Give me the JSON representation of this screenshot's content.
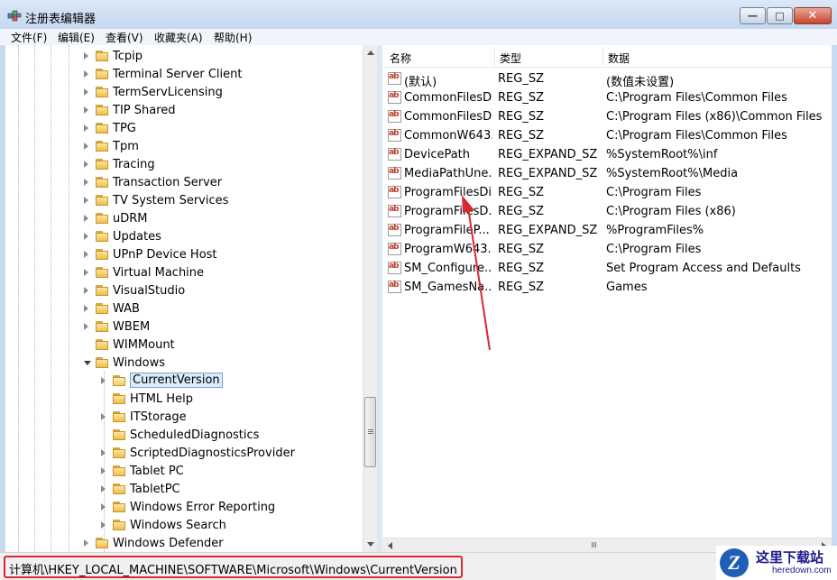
{
  "window": {
    "title": "注册表编辑器",
    "minimize_glyph": "—",
    "maximize_glyph": "□",
    "close_glyph": "✕"
  },
  "menu": [
    "文件(F)",
    "编辑(E)",
    "查看(V)",
    "收藏夹(A)",
    "帮助(H)"
  ],
  "tree": [
    {
      "label": "Tcpip",
      "level": 0,
      "state": "collapsed"
    },
    {
      "label": "Terminal Server Client",
      "level": 0,
      "state": "collapsed"
    },
    {
      "label": "TermServLicensing",
      "level": 0,
      "state": "collapsed"
    },
    {
      "label": "TIP Shared",
      "level": 0,
      "state": "collapsed"
    },
    {
      "label": "TPG",
      "level": 0,
      "state": "collapsed"
    },
    {
      "label": "Tpm",
      "level": 0,
      "state": "collapsed"
    },
    {
      "label": "Tracing",
      "level": 0,
      "state": "collapsed"
    },
    {
      "label": "Transaction Server",
      "level": 0,
      "state": "collapsed"
    },
    {
      "label": "TV System Services",
      "level": 0,
      "state": "collapsed"
    },
    {
      "label": "uDRM",
      "level": 0,
      "state": "collapsed"
    },
    {
      "label": "Updates",
      "level": 0,
      "state": "collapsed"
    },
    {
      "label": "UPnP Device Host",
      "level": 0,
      "state": "collapsed"
    },
    {
      "label": "Virtual Machine",
      "level": 0,
      "state": "collapsed"
    },
    {
      "label": "VisualStudio",
      "level": 0,
      "state": "collapsed"
    },
    {
      "label": "WAB",
      "level": 0,
      "state": "collapsed"
    },
    {
      "label": "WBEM",
      "level": 0,
      "state": "collapsed"
    },
    {
      "label": "WIMMount",
      "level": 0,
      "state": "none"
    },
    {
      "label": "Windows",
      "level": 0,
      "state": "expanded"
    },
    {
      "label": "CurrentVersion",
      "level": 1,
      "state": "collapsed",
      "selected": true
    },
    {
      "label": "HTML Help",
      "level": 1,
      "state": "none"
    },
    {
      "label": "ITStorage",
      "level": 1,
      "state": "collapsed"
    },
    {
      "label": "ScheduledDiagnostics",
      "level": 1,
      "state": "none"
    },
    {
      "label": "ScriptedDiagnosticsProvider",
      "level": 1,
      "state": "collapsed"
    },
    {
      "label": "Tablet PC",
      "level": 1,
      "state": "collapsed"
    },
    {
      "label": "TabletPC",
      "level": 1,
      "state": "collapsed"
    },
    {
      "label": "Windows Error Reporting",
      "level": 1,
      "state": "collapsed"
    },
    {
      "label": "Windows Search",
      "level": 1,
      "state": "collapsed"
    },
    {
      "label": "Windows Defender",
      "level": 0,
      "state": "collapsed"
    }
  ],
  "list": {
    "headers": {
      "name": "名称",
      "type": "类型",
      "data": "数据"
    },
    "rows": [
      {
        "name": "(默认)",
        "type": "REG_SZ",
        "data": "(数值未设置)"
      },
      {
        "name": "CommonFilesDir",
        "type": "REG_SZ",
        "data": "C:\\Program Files\\Common Files"
      },
      {
        "name": "CommonFilesD...",
        "type": "REG_SZ",
        "data": "C:\\Program Files (x86)\\Common Files"
      },
      {
        "name": "CommonW643...",
        "type": "REG_SZ",
        "data": "C:\\Program Files\\Common Files"
      },
      {
        "name": "DevicePath",
        "type": "REG_EXPAND_SZ",
        "data": "%SystemRoot%\\inf"
      },
      {
        "name": "MediaPathUne...",
        "type": "REG_EXPAND_SZ",
        "data": "%SystemRoot%\\Media"
      },
      {
        "name": "ProgramFilesDir",
        "type": "REG_SZ",
        "data": "C:\\Program Files"
      },
      {
        "name": "ProgramFilesD...",
        "type": "REG_SZ",
        "data": "C:\\Program Files (x86)"
      },
      {
        "name": "ProgramFileP...",
        "type": "REG_EXPAND_SZ",
        "data": "%ProgramFiles%"
      },
      {
        "name": "ProgramW643...",
        "type": "REG_SZ",
        "data": "C:\\Program Files"
      },
      {
        "name": "SM_Configure...",
        "type": "REG_SZ",
        "data": "Set Program Access and Defaults"
      },
      {
        "name": "SM_GamesNa...",
        "type": "REG_SZ",
        "data": "Games"
      }
    ],
    "value_icon_text": "ab"
  },
  "statusbar": {
    "path": "计算机\\HKEY_LOCAL_MACHINE\\SOFTWARE\\Microsoft\\Windows\\CurrentVersion"
  },
  "watermark": {
    "logo_letter": "Z",
    "title": "这里下载站",
    "subtitle": "heredown.com"
  },
  "colors": {
    "annotation": "#d9292e",
    "selection": "#dcebfc"
  }
}
